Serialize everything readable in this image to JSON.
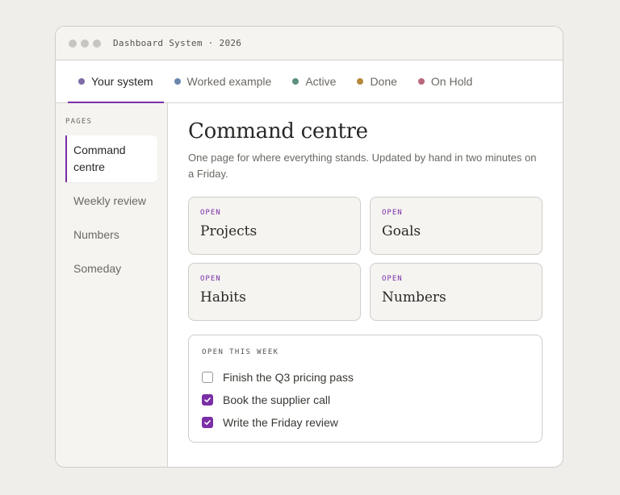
{
  "window": {
    "title": "Dashboard System · 2026"
  },
  "tabs": [
    {
      "label": "Your system",
      "color": "#7e6aa6",
      "active": true
    },
    {
      "label": "Worked example",
      "color": "#6a86ad",
      "active": false
    },
    {
      "label": "Active",
      "color": "#5e8f7e",
      "active": false
    },
    {
      "label": "Done",
      "color": "#b38a3a",
      "active": false
    },
    {
      "label": "On Hold",
      "color": "#b86a7c",
      "active": false
    }
  ],
  "sidebar": {
    "heading": "PAGES",
    "items": [
      {
        "label": "Command centre",
        "active": true
      },
      {
        "label": "Weekly review",
        "active": false
      },
      {
        "label": "Numbers",
        "active": false
      },
      {
        "label": "Someday",
        "active": false
      }
    ]
  },
  "main": {
    "title": "Command centre",
    "subtitle": "One page for where everything stands. Updated by hand in two minutes on a Friday.",
    "cards": [
      {
        "tag": "OPEN",
        "title": "Projects"
      },
      {
        "tag": "OPEN",
        "title": "Goals"
      },
      {
        "tag": "OPEN",
        "title": "Habits"
      },
      {
        "tag": "OPEN",
        "title": "Numbers"
      }
    ],
    "todo": {
      "heading": "OPEN THIS WEEK",
      "items": [
        {
          "label": "Finish the Q3 pricing pass",
          "checked": false
        },
        {
          "label": "Book the supplier call",
          "checked": true
        },
        {
          "label": "Write the Friday review",
          "checked": true
        }
      ]
    }
  },
  "colors": {
    "accent": "#7b2fa6",
    "background": "#efeeeb",
    "panel": "#f5f4f1"
  }
}
